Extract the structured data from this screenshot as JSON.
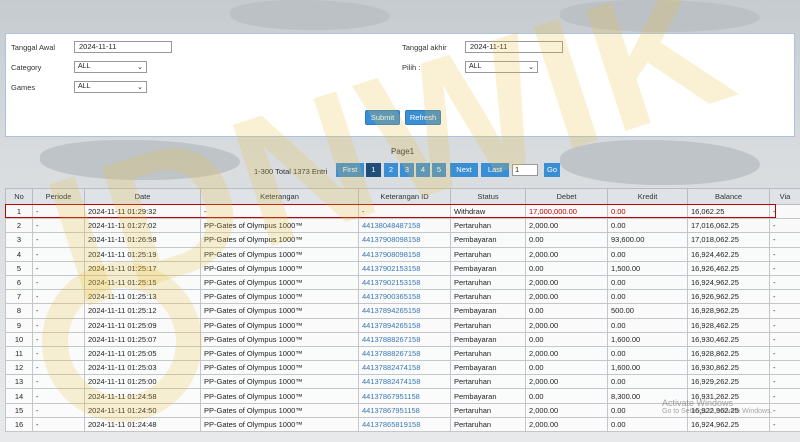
{
  "filters": {
    "tanggal_awal_label": "Tanggal Awal",
    "tanggal_awal_value": "2024-11-11",
    "tanggal_akhir_label": "Tanggal akhir",
    "tanggal_akhir_value": "2024-11-11",
    "category_label": "Category",
    "category_value": "ALL",
    "pilih_label": "Pilih :",
    "pilih_value": "ALL",
    "games_label": "Games",
    "games_value": "ALL",
    "submit_label": "Submit",
    "refresh_label": "Refresh"
  },
  "pager": {
    "title": "Page1",
    "info": "1-300 Total 1373 Entri",
    "first": "First",
    "pages": [
      "1",
      "2",
      "3",
      "4",
      "5"
    ],
    "next": "Next",
    "last": "Last",
    "input_value": "1",
    "go": "Go"
  },
  "table": {
    "headers": [
      "No",
      "Periode",
      "Date",
      "Keterangan",
      "Keterangan ID",
      "Status",
      "Debet",
      "Kredit",
      "Balance",
      "Via"
    ],
    "rows": [
      [
        "1",
        "-",
        "2024-11-11 01:29:32",
        "-",
        "-",
        "Withdraw",
        "17,000,000.00",
        "0.00",
        "16,062.25",
        "-"
      ],
      [
        "2",
        "-",
        "2024-11-11 01:27:02",
        "PP-Gates of Olympus 1000™",
        "44138048487158",
        "Pertaruhan",
        "2,000.00",
        "0.00",
        "17,016,062.25",
        "-"
      ],
      [
        "3",
        "-",
        "2024-11-11 01:26:58",
        "PP-Gates of Olympus 1000™",
        "44137908098158",
        "Pembayaran",
        "0.00",
        "93,600.00",
        "17,018,062.25",
        "-"
      ],
      [
        "4",
        "-",
        "2024-11-11 01:25:19",
        "PP-Gates of Olympus 1000™",
        "44137908098158",
        "Pertaruhan",
        "2,000.00",
        "0.00",
        "16,924,462.25",
        "-"
      ],
      [
        "5",
        "-",
        "2024-11-11 01:25:17",
        "PP-Gates of Olympus 1000™",
        "44137902153158",
        "Pembayaran",
        "0.00",
        "1,500.00",
        "16,926,462.25",
        "-"
      ],
      [
        "6",
        "-",
        "2024-11-11 01:25:15",
        "PP-Gates of Olympus 1000™",
        "44137902153158",
        "Pertaruhan",
        "2,000.00",
        "0.00",
        "16,924,962.25",
        "-"
      ],
      [
        "7",
        "-",
        "2024-11-11 01:25:13",
        "PP-Gates of Olympus 1000™",
        "44137900365158",
        "Pertaruhan",
        "2,000.00",
        "0.00",
        "16,926,962.25",
        "-"
      ],
      [
        "8",
        "-",
        "2024-11-11 01:25:12",
        "PP-Gates of Olympus 1000™",
        "44137894265158",
        "Pembayaran",
        "0.00",
        "500.00",
        "16,928,962.25",
        "-"
      ],
      [
        "9",
        "-",
        "2024-11-11 01:25:09",
        "PP-Gates of Olympus 1000™",
        "44137894265158",
        "Pertaruhan",
        "2,000.00",
        "0.00",
        "16,928,462.25",
        "-"
      ],
      [
        "10",
        "-",
        "2024-11-11 01:25:07",
        "PP-Gates of Olympus 1000™",
        "44137888267158",
        "Pembayaran",
        "0.00",
        "1,600.00",
        "16,930,462.25",
        "-"
      ],
      [
        "11",
        "-",
        "2024-11-11 01:25:05",
        "PP-Gates of Olympus 1000™",
        "44137888267158",
        "Pertaruhan",
        "2,000.00",
        "0.00",
        "16,928,862.25",
        "-"
      ],
      [
        "12",
        "-",
        "2024-11-11 01:25:03",
        "PP-Gates of Olympus 1000™",
        "44137882474158",
        "Pembayaran",
        "0.00",
        "1,600.00",
        "16,930,862.25",
        "-"
      ],
      [
        "13",
        "-",
        "2024-11-11 01:25:00",
        "PP-Gates of Olympus 1000™",
        "44137882474158",
        "Pertaruhan",
        "2,000.00",
        "0.00",
        "16,929,262.25",
        "-"
      ],
      [
        "14",
        "-",
        "2024-11-11 01:24:58",
        "PP-Gates of Olympus 1000™",
        "44137867951158",
        "Pembayaran",
        "0.00",
        "8,300.00",
        "16,931,262.25",
        "-"
      ],
      [
        "15",
        "-",
        "2024-11-11 01:24:50",
        "PP-Gates of Olympus 1000™",
        "44137867951158",
        "Pertaruhan",
        "2,000.00",
        "0.00",
        "16,922,962.25",
        "-"
      ],
      [
        "16",
        "-",
        "2024-11-11 01:24:48",
        "PP-Gates of Olympus 1000™",
        "44137865819158",
        "Pertaruhan",
        "2,000.00",
        "0.00",
        "16,924,962.25",
        "-"
      ]
    ]
  },
  "overlay": {
    "watermark": "IDNWIK",
    "activate_title": "Activate Windows",
    "activate_sub": "Go to Settings to activate Windows."
  },
  "colors": {
    "button": "#3a8ed6",
    "active_page": "#1f4e78",
    "highlight": "#c00000",
    "link": "#3a78b5"
  }
}
